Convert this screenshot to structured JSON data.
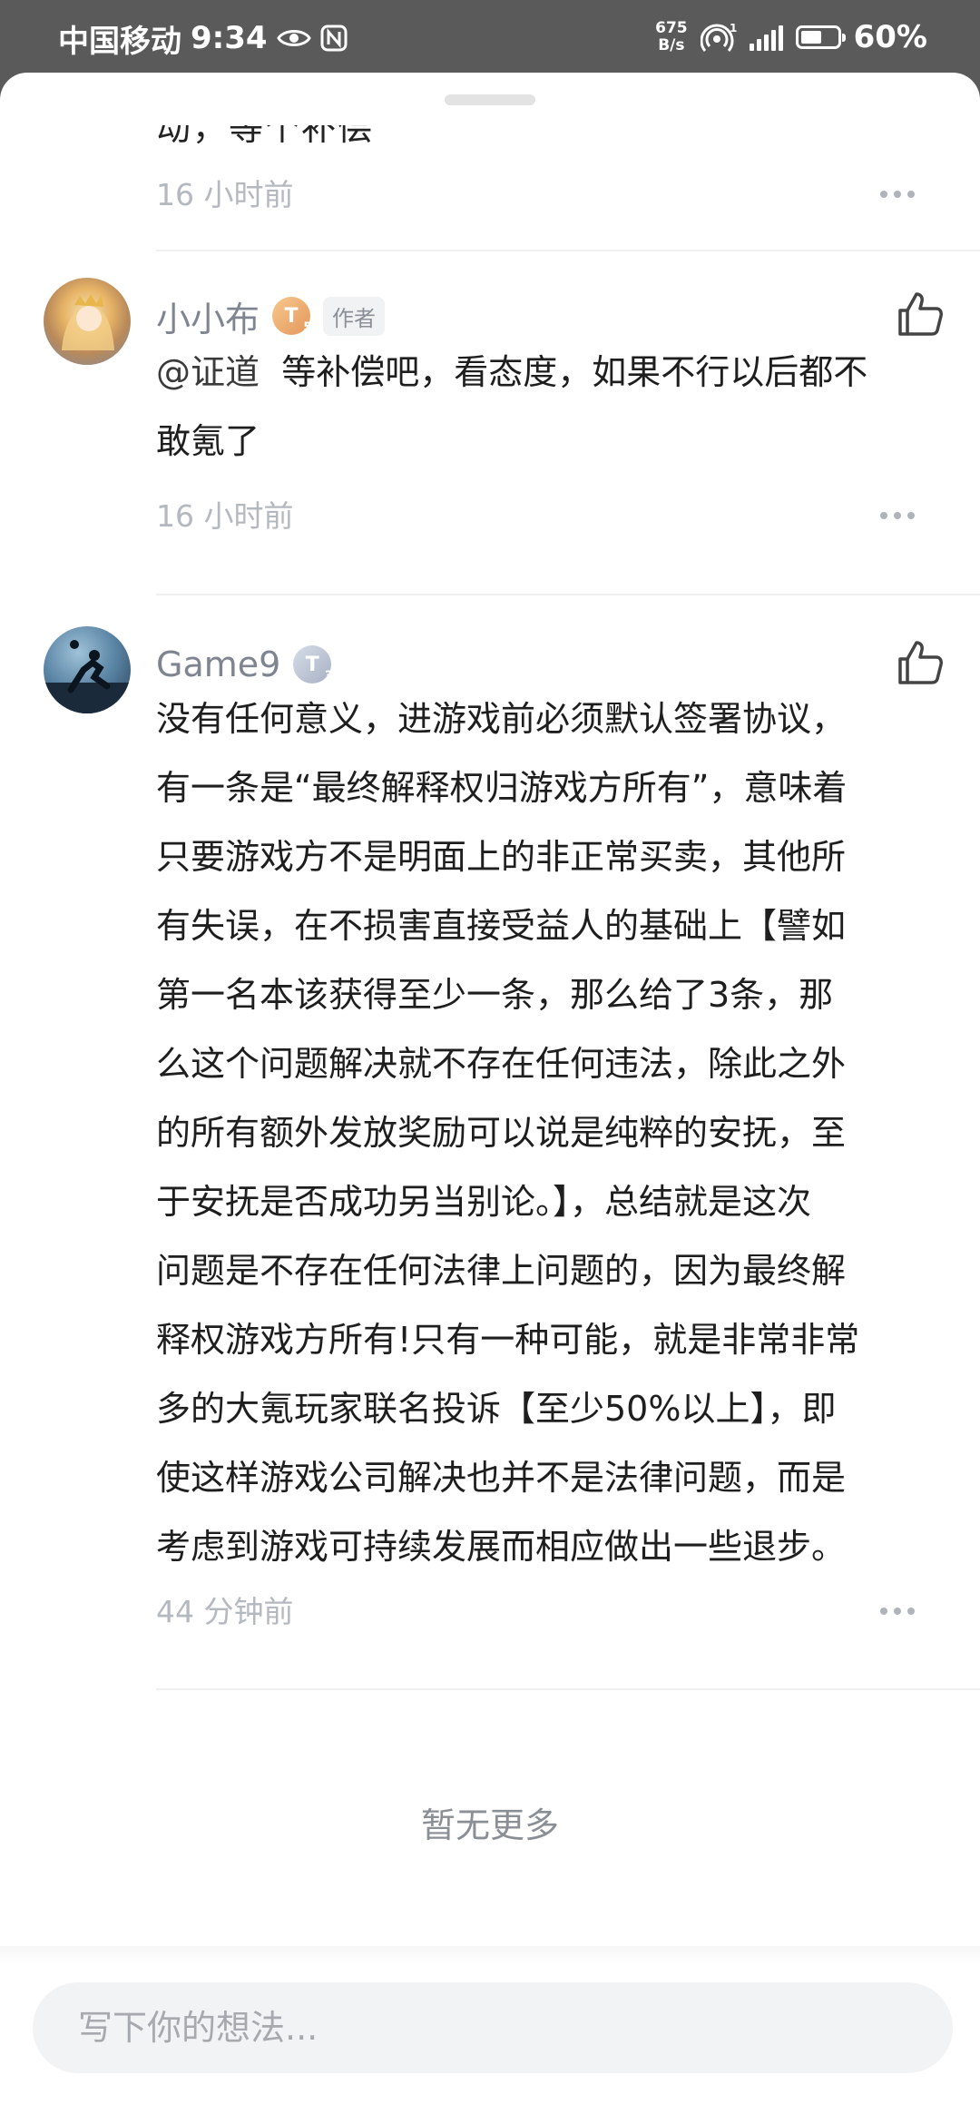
{
  "status_bar": {
    "carrier": "中国移动",
    "time": "9:34",
    "net_speed_value": "675",
    "net_speed_unit": "B/s",
    "battery": "60%"
  },
  "comments": [
    {
      "partial_text": "动，等个补偿",
      "time": "16 小时前"
    },
    {
      "username": "小小布",
      "level": "T",
      "level_sub": "5",
      "tag": "作者",
      "mention": "@证道",
      "text_line1": "等补偿吧，看态度，如果不行以后都不",
      "text_line2": "敢氪了",
      "time": "16 小时前"
    },
    {
      "username": "Game9",
      "level": "T",
      "level_sub": "3",
      "lines": [
        "没有任何意义，进游戏前必须默认签署协议，",
        "有一条是“最终解释权归游戏方所有”，意味着",
        "只要游戏方不是明面上的非正常买卖，其他所",
        "有失误，在不损害直接受益人的基础上【譬如",
        "第一名本该获得至少一条，那么给了3条，那",
        "么这个问题解决就不存在任何违法，除此之外",
        "的所有额外发放奖励可以说是纯粹的安抚，至",
        "于安抚是否成功另当别论。】，总结就是这次",
        "问题是不存在任何法律上问题的，因为最终解",
        "释权游戏方所有!只有一种可能，就是非常非常",
        "多的大氪玩家联名投诉【至少50%以上】，即",
        "使这样游戏公司解决也并不是法律问题，而是",
        "考虑到游戏可持续发展而相应做出一些退步。"
      ],
      "time": "44 分钟前"
    }
  ],
  "no_more": "暂无更多",
  "input": {
    "placeholder": "写下你的想法..."
  }
}
